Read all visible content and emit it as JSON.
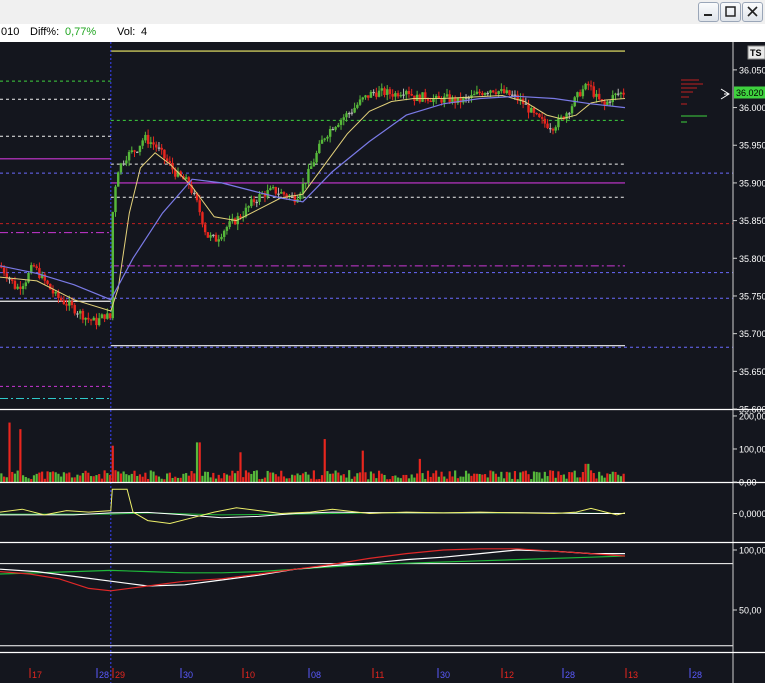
{
  "infobar": {
    "date_fragment": "010",
    "diff_label": "Diff%:",
    "diff_value": "0,77%",
    "vol_label": "Vol:",
    "vol_value": "4"
  },
  "window_controls": [
    "minimize-icon",
    "maximize-icon",
    "close-icon"
  ],
  "ts_badge": "TS",
  "last_price_tag": "36.020",
  "colors": {
    "background": "#14161e",
    "up": "#56b83a",
    "down": "#e8261e",
    "neutral": "#b8b8b8",
    "ma_fast": "#e3d17a",
    "ma_slow": "#7a7ae6",
    "level_white": "#f0f0f0",
    "level_green": "#3ed13e",
    "level_magenta": "#c936d4",
    "level_blue": "#6a6aff",
    "level_red": "#c02020",
    "level_yellow": "#f2ef6a",
    "level_cyan": "#2ec9c9",
    "session_line": "#3a44ff",
    "osc_yellow": "#eef06a",
    "stoch_red": "#e02828",
    "stoch_white": "#ffffff",
    "stoch_green": "#1fb83a"
  },
  "chart_data": [
    {
      "type": "candlestick",
      "panel": "price",
      "yticks": [
        "36.050",
        "36.000",
        "35.950",
        "35.900",
        "35.850",
        "35.800",
        "35.750",
        "35.700",
        "35.650",
        "35.600"
      ],
      "yvalues": [
        36.05,
        36.0,
        35.95,
        35.9,
        35.85,
        35.8,
        35.75,
        35.7,
        35.65,
        35.6
      ],
      "ylim": [
        35.6,
        36.087
      ],
      "x_labels": [
        "17",
        "28",
        "29",
        "30",
        "10",
        "08",
        "11",
        "30",
        "12",
        "28",
        "13",
        "28"
      ],
      "levels": [
        {
          "value": 36.075,
          "color": "level_yellow",
          "style": "solid",
          "from": 0.15
        },
        {
          "value": 36.035,
          "color": "level_green",
          "style": "dashed",
          "to": 0.15
        },
        {
          "value": 36.011,
          "color": "level_white",
          "style": "dashed",
          "to": 0.15
        },
        {
          "value": 35.983,
          "color": "level_green",
          "style": "dashed",
          "from": 0.15
        },
        {
          "value": 35.962,
          "color": "level_white",
          "style": "dashed",
          "to": 0.15
        },
        {
          "value": 35.932,
          "color": "level_magenta",
          "style": "solid",
          "to": 0.15
        },
        {
          "value": 35.925,
          "color": "level_white",
          "style": "dashed",
          "from": 0.15
        },
        {
          "value": 35.913,
          "color": "level_blue",
          "style": "dashed"
        },
        {
          "value": 35.9,
          "color": "level_magenta",
          "style": "solid",
          "from": 0.15
        },
        {
          "value": 35.881,
          "color": "level_white",
          "style": "dashed",
          "from": 0.15
        },
        {
          "value": 35.846,
          "color": "level_red",
          "style": "dashed"
        },
        {
          "value": 35.834,
          "color": "level_magenta",
          "style": "dashdot",
          "to": 0.15
        },
        {
          "value": 35.79,
          "color": "level_magenta",
          "style": "dashdot",
          "from": 0.15
        },
        {
          "value": 35.781,
          "color": "level_blue",
          "style": "dashed"
        },
        {
          "value": 35.747,
          "color": "level_blue",
          "style": "dashed"
        },
        {
          "value": 35.743,
          "color": "level_white",
          "style": "solid",
          "to": 0.15
        },
        {
          "value": 35.684,
          "color": "level_white",
          "style": "solid",
          "from": 0.15
        },
        {
          "value": 35.682,
          "color": "level_blue",
          "style": "dashed"
        },
        {
          "value": 35.63,
          "color": "level_magenta",
          "style": "dashed",
          "to": 0.15
        },
        {
          "value": 35.614,
          "color": "level_cyan",
          "style": "dashdot",
          "to": 0.15
        }
      ],
      "close_path": [
        [
          0,
          35.79
        ],
        [
          0.012,
          35.775
        ],
        [
          0.022,
          35.76
        ],
        [
          0.034,
          35.77
        ],
        [
          0.045,
          35.79
        ],
        [
          0.06,
          35.77
        ],
        [
          0.075,
          35.75
        ],
        [
          0.09,
          35.74
        ],
        [
          0.105,
          35.73
        ],
        [
          0.118,
          35.72
        ],
        [
          0.13,
          35.715
        ],
        [
          0.142,
          35.725
        ],
        [
          0.15,
          35.72
        ],
        [
          0.152,
          35.855
        ],
        [
          0.158,
          35.915
        ],
        [
          0.17,
          35.935
        ],
        [
          0.185,
          35.945
        ],
        [
          0.195,
          35.96
        ],
        [
          0.21,
          35.95
        ],
        [
          0.225,
          35.93
        ],
        [
          0.24,
          35.91
        ],
        [
          0.255,
          35.9
        ],
        [
          0.268,
          35.87
        ],
        [
          0.28,
          35.83
        ],
        [
          0.292,
          35.825
        ],
        [
          0.305,
          35.84
        ],
        [
          0.318,
          35.85
        ],
        [
          0.33,
          35.86
        ],
        [
          0.342,
          35.875
        ],
        [
          0.355,
          35.885
        ],
        [
          0.37,
          35.89
        ],
        [
          0.385,
          35.885
        ],
        [
          0.4,
          35.88
        ],
        [
          0.412,
          35.9
        ],
        [
          0.425,
          35.93
        ],
        [
          0.438,
          35.96
        ],
        [
          0.45,
          35.975
        ],
        [
          0.462,
          35.985
        ],
        [
          0.475,
          35.995
        ],
        [
          0.49,
          36.01
        ],
        [
          0.505,
          36.02
        ],
        [
          0.52,
          36.02
        ],
        [
          0.535,
          36.018
        ],
        [
          0.55,
          36.025
        ],
        [
          0.562,
          36.012
        ],
        [
          0.575,
          36.015
        ],
        [
          0.59,
          36.01
        ],
        [
          0.605,
          36.012
        ],
        [
          0.62,
          36.008
        ],
        [
          0.635,
          36.012
        ],
        [
          0.65,
          36.02
        ],
        [
          0.665,
          36.025
        ],
        [
          0.68,
          36.02
        ],
        [
          0.695,
          36.015
        ],
        [
          0.71,
          36.005
        ],
        [
          0.722,
          35.99
        ],
        [
          0.735,
          35.98
        ],
        [
          0.748,
          35.975
        ],
        [
          0.76,
          35.985
        ],
        [
          0.772,
          36.0
        ],
        [
          0.785,
          36.02
        ],
        [
          0.797,
          36.03
        ],
        [
          0.808,
          36.012
        ],
        [
          0.818,
          36.002
        ],
        [
          0.826,
          36.012
        ],
        [
          0.836,
          36.018
        ],
        [
          0.846,
          36.02
        ]
      ],
      "ma_fast_path": [
        [
          0,
          35.775
        ],
        [
          0.05,
          35.77
        ],
        [
          0.1,
          35.745
        ],
        [
          0.15,
          35.73
        ],
        [
          0.16,
          35.76
        ],
        [
          0.175,
          35.86
        ],
        [
          0.19,
          35.92
        ],
        [
          0.21,
          35.94
        ],
        [
          0.23,
          35.925
        ],
        [
          0.26,
          35.895
        ],
        [
          0.29,
          35.855
        ],
        [
          0.32,
          35.85
        ],
        [
          0.35,
          35.865
        ],
        [
          0.38,
          35.88
        ],
        [
          0.41,
          35.885
        ],
        [
          0.44,
          35.925
        ],
        [
          0.47,
          35.965
        ],
        [
          0.5,
          35.995
        ],
        [
          0.53,
          36.008
        ],
        [
          0.56,
          36.012
        ],
        [
          0.6,
          36.012
        ],
        [
          0.64,
          36.014
        ],
        [
          0.68,
          36.016
        ],
        [
          0.71,
          36.008
        ],
        [
          0.74,
          35.99
        ],
        [
          0.76,
          35.985
        ],
        [
          0.78,
          35.99
        ],
        [
          0.8,
          36.006
        ],
        [
          0.82,
          36.01
        ],
        [
          0.846,
          36.012
        ]
      ],
      "ma_slow_path": [
        [
          0,
          35.79
        ],
        [
          0.05,
          35.78
        ],
        [
          0.1,
          35.765
        ],
        [
          0.15,
          35.745
        ],
        [
          0.18,
          35.8
        ],
        [
          0.22,
          35.86
        ],
        [
          0.26,
          35.905
        ],
        [
          0.3,
          35.9
        ],
        [
          0.34,
          35.89
        ],
        [
          0.38,
          35.88
        ],
        [
          0.41,
          35.875
        ],
        [
          0.45,
          35.915
        ],
        [
          0.5,
          35.955
        ],
        [
          0.55,
          35.99
        ],
        [
          0.6,
          36.005
        ],
        [
          0.65,
          36.012
        ],
        [
          0.7,
          36.015
        ],
        [
          0.75,
          36.012
        ],
        [
          0.8,
          36.005
        ],
        [
          0.846,
          36.0
        ]
      ]
    },
    {
      "type": "bar",
      "panel": "volume",
      "yticks": [
        "200,00",
        "100,00",
        "0,00"
      ],
      "yvalues": [
        200,
        100,
        0
      ],
      "ylim": [
        0,
        215
      ],
      "spike_positions": [
        0.012,
        0.028,
        0.152,
        0.268,
        0.325,
        0.44,
        0.49,
        0.568,
        0.795
      ],
      "spike_values": [
        180,
        160,
        110,
        120,
        90,
        130,
        95,
        70,
        55
      ]
    },
    {
      "type": "line",
      "panel": "oscillator",
      "yticks": [
        "0,0000"
      ],
      "ylim": [
        -1,
        1
      ],
      "yellow_path": [
        [
          0,
          0.05
        ],
        [
          0.03,
          0.15
        ],
        [
          0.06,
          -0.05
        ],
        [
          0.09,
          0.1
        ],
        [
          0.12,
          0.05
        ],
        [
          0.15,
          0.1
        ],
        [
          0.152,
          0.85
        ],
        [
          0.172,
          0.85
        ],
        [
          0.18,
          0.05
        ],
        [
          0.2,
          -0.25
        ],
        [
          0.23,
          -0.35
        ],
        [
          0.26,
          -0.15
        ],
        [
          0.29,
          0.05
        ],
        [
          0.32,
          0.2
        ],
        [
          0.35,
          0.1
        ],
        [
          0.38,
          0.0
        ],
        [
          0.42,
          0.05
        ],
        [
          0.45,
          0.15
        ],
        [
          0.5,
          0.0
        ],
        [
          0.55,
          0.05
        ],
        [
          0.6,
          0.02
        ],
        [
          0.65,
          0.05
        ],
        [
          0.7,
          0.02
        ],
        [
          0.75,
          0.0
        ],
        [
          0.78,
          0.05
        ],
        [
          0.8,
          0.18
        ],
        [
          0.82,
          0.05
        ],
        [
          0.835,
          -0.05
        ],
        [
          0.846,
          0.02
        ]
      ],
      "white_path": [
        [
          0,
          -0.05
        ],
        [
          0.1,
          -0.05
        ],
        [
          0.15,
          0.02
        ],
        [
          0.2,
          0.04
        ],
        [
          0.25,
          -0.05
        ],
        [
          0.3,
          -0.15
        ],
        [
          0.35,
          -0.1
        ],
        [
          0.4,
          0.0
        ],
        [
          0.45,
          0.05
        ],
        [
          0.5,
          0.03
        ],
        [
          0.6,
          0.02
        ],
        [
          0.7,
          0.03
        ],
        [
          0.8,
          0.0
        ],
        [
          0.846,
          0.0
        ]
      ],
      "green_path": [
        [
          0,
          -0.02
        ],
        [
          0.15,
          -0.02
        ],
        [
          0.2,
          0.02
        ],
        [
          0.3,
          -0.05
        ],
        [
          0.4,
          -0.02
        ],
        [
          0.5,
          0.02
        ],
        [
          0.6,
          0.02
        ],
        [
          0.7,
          0.02
        ],
        [
          0.8,
          0.01
        ],
        [
          0.846,
          0.0
        ]
      ]
    },
    {
      "type": "line",
      "panel": "stochastic",
      "yticks": [
        "100,00",
        "50,00"
      ],
      "yvalues": [
        100,
        50
      ],
      "ylim": [
        15,
        105
      ],
      "hlines": [
        88.6,
        20.2
      ],
      "red_path": [
        [
          0,
          82
        ],
        [
          0.04,
          80
        ],
        [
          0.08,
          76
        ],
        [
          0.12,
          68
        ],
        [
          0.15,
          66
        ],
        [
          0.2,
          70
        ],
        [
          0.25,
          74
        ],
        [
          0.3,
          76
        ],
        [
          0.35,
          80
        ],
        [
          0.4,
          84
        ],
        [
          0.45,
          88
        ],
        [
          0.5,
          93
        ],
        [
          0.55,
          97
        ],
        [
          0.6,
          100
        ],
        [
          0.65,
          101
        ],
        [
          0.7,
          101
        ],
        [
          0.75,
          99
        ],
        [
          0.8,
          97
        ],
        [
          0.846,
          95
        ]
      ],
      "white_path": [
        [
          0,
          84
        ],
        [
          0.05,
          82
        ],
        [
          0.1,
          78
        ],
        [
          0.15,
          74
        ],
        [
          0.2,
          70
        ],
        [
          0.25,
          71
        ],
        [
          0.3,
          75
        ],
        [
          0.35,
          79
        ],
        [
          0.4,
          84
        ],
        [
          0.45,
          87
        ],
        [
          0.5,
          89
        ],
        [
          0.55,
          92
        ],
        [
          0.6,
          94
        ],
        [
          0.65,
          97
        ],
        [
          0.7,
          100
        ],
        [
          0.75,
          99
        ],
        [
          0.8,
          97
        ],
        [
          0.846,
          97
        ]
      ],
      "green_path": [
        [
          0,
          80
        ],
        [
          0.1,
          82
        ],
        [
          0.15,
          83
        ],
        [
          0.2,
          82
        ],
        [
          0.25,
          81
        ],
        [
          0.3,
          81
        ],
        [
          0.35,
          82
        ],
        [
          0.4,
          84
        ],
        [
          0.45,
          86
        ],
        [
          0.5,
          88
        ],
        [
          0.55,
          89
        ],
        [
          0.6,
          90
        ],
        [
          0.65,
          91
        ],
        [
          0.7,
          92
        ],
        [
          0.75,
          93
        ],
        [
          0.8,
          94
        ],
        [
          0.846,
          95
        ]
      ]
    }
  ]
}
